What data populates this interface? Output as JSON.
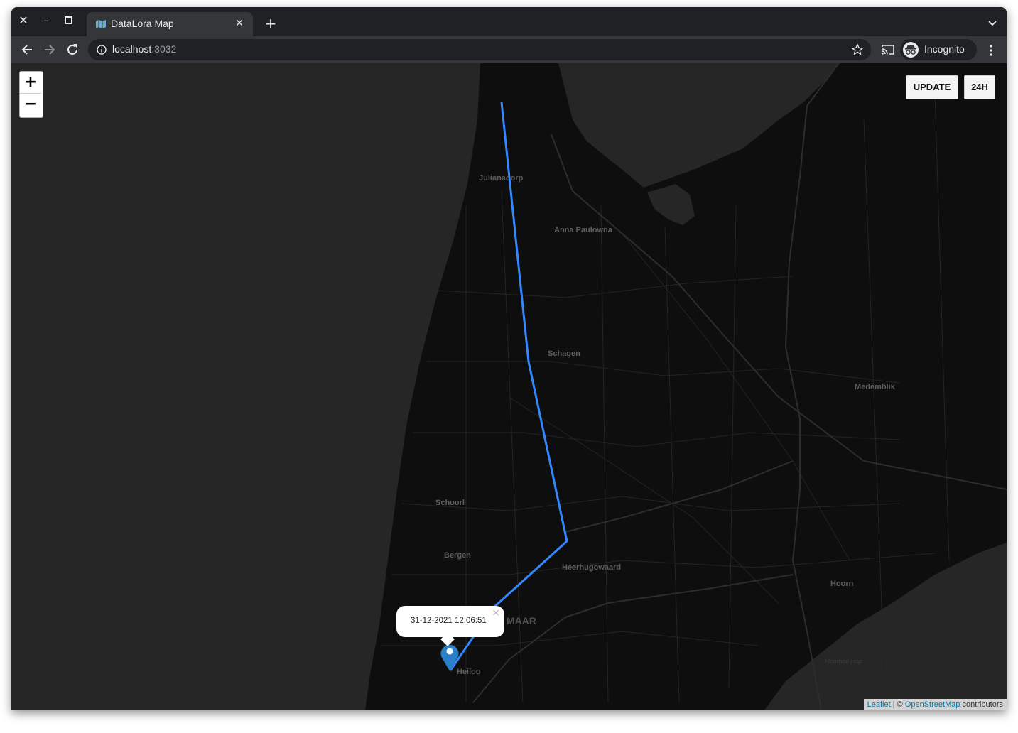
{
  "browser": {
    "tab_title": "DataLora Map",
    "url_host": "localhost",
    "url_port": ":3032",
    "profile_label": "Incognito"
  },
  "map": {
    "controls": {
      "zoom_in_label": "+",
      "zoom_out_label": "−",
      "update_label": "UPDATE",
      "range_label": "24H"
    },
    "places": [
      "Julianadorp",
      "Anna Paulowna",
      "Schagen",
      "Medemblik",
      "Schoorl",
      "Bergen",
      "Heerhugowaard",
      "MAAR",
      "Hoorn",
      "Heiloo",
      "Hoornse Hop"
    ],
    "popup": {
      "timestamp": "31-12-2021 12:06:51",
      "close_label": "×"
    },
    "track_color": "#3388ff",
    "marker_color": "#2a81cb",
    "attribution": {
      "leaflet": "Leaflet",
      "separator": " | © ",
      "osm": "OpenStreetMap",
      "suffix": " contributors"
    }
  }
}
